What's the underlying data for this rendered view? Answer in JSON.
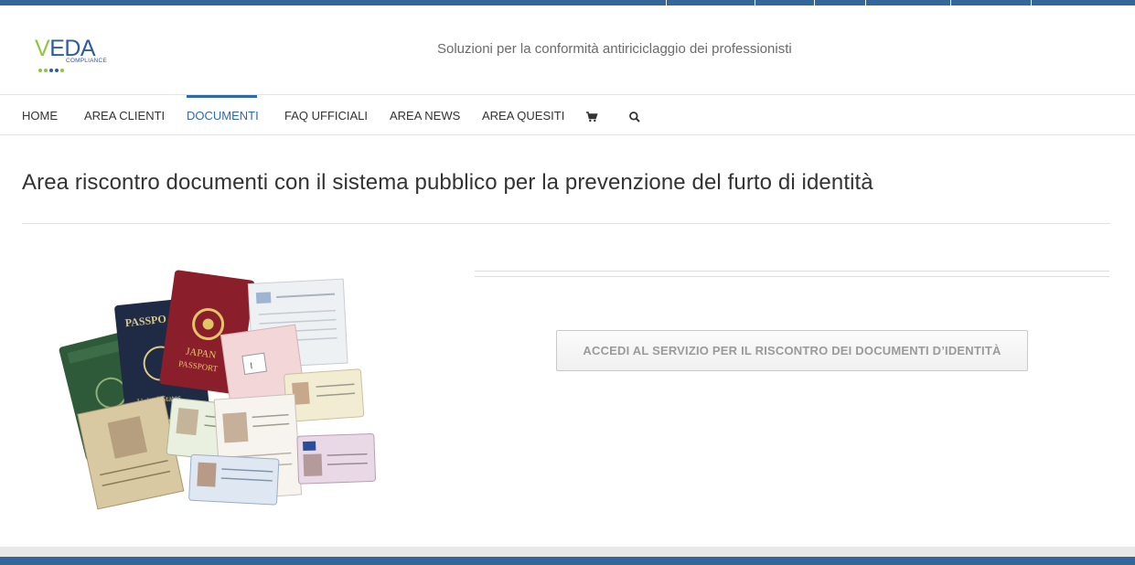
{
  "brand": {
    "logo_letter_v": "V",
    "logo_letters_rest": "EDA",
    "logo_subtitle": "COMPLIANCE",
    "logo_dot_colors": [
      "#8dc63f",
      "#8dc63f",
      "#2e5d9f",
      "#2e5d9f",
      "#8dc63f"
    ],
    "tagline": "Soluzioni per la conformità antiriciclaggio dei professionisti"
  },
  "nav": {
    "items": [
      {
        "label": "HOME",
        "active": false
      },
      {
        "label": "AREA CLIENTI",
        "active": false
      },
      {
        "label": "DOCUMENTI",
        "active": true
      },
      {
        "label": "FAQ UFFICIALI",
        "active": false
      },
      {
        "label": "AREA NEWS",
        "active": false
      },
      {
        "label": "AREA QUESITI",
        "active": false
      }
    ],
    "icons": [
      "cart-icon",
      "search-icon"
    ]
  },
  "main": {
    "title": "Area riscontro documenti con il sistema pubblico per la prevenzione del furto di identità",
    "image_subject": "identity-documents-collage",
    "cta_label": "ACCEDI AL SERVIZIO PER IL RISCONTRO DEI DOCUMENTI D’IDENTITÀ"
  },
  "colors": {
    "brand_blue": "#336699",
    "accent_blue": "#2e6aa8",
    "logo_green": "#8dc63f"
  }
}
